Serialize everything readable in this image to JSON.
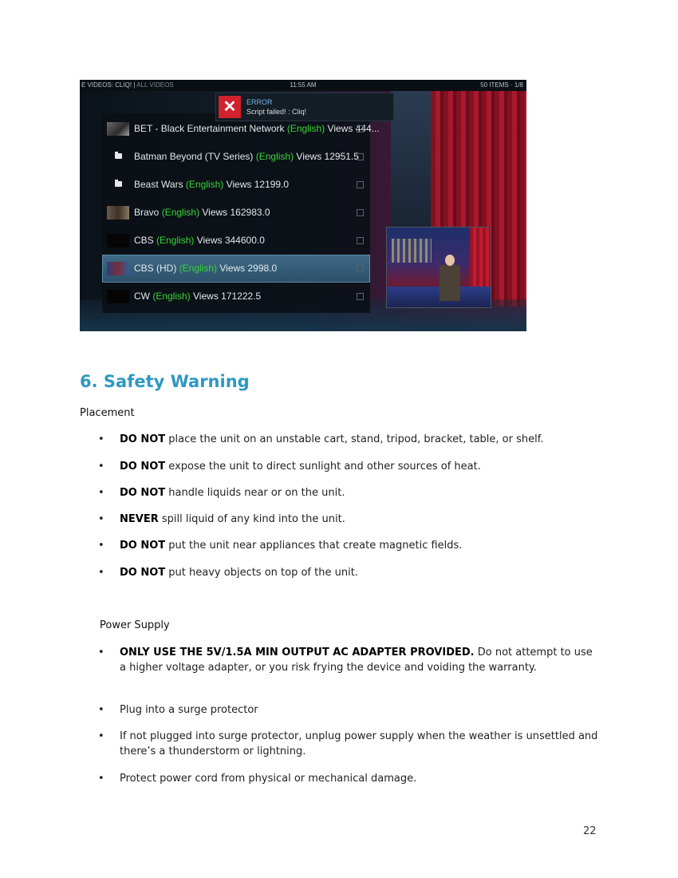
{
  "screenshot": {
    "breadcrumb_main": "E VIDEOS: CLIQ!",
    "breadcrumb_sub": "ALL VIDEOS",
    "clock": "11:55 AM",
    "items_count": "50 ITEMS · 1/8",
    "error": {
      "title": "ERROR",
      "message": "Script failed! : Cliq!"
    },
    "rows": [
      {
        "name": "BET - Black Entertainment Network",
        "lang": "(English)",
        "views": "Views 444...",
        "thumb": "img1",
        "selected": false
      },
      {
        "name": "Batman Beyond (TV Series)",
        "lang": "(English)",
        "views": "Views 12951.5",
        "thumb": "folder",
        "selected": false
      },
      {
        "name": "Beast Wars",
        "lang": "(English)",
        "views": "Views 12199.0",
        "thumb": "folder",
        "selected": false
      },
      {
        "name": "Bravo",
        "lang": "(English)",
        "views": "Views 162983.0",
        "thumb": "img2",
        "selected": false
      },
      {
        "name": "CBS",
        "lang": "(English)",
        "views": "Views 344600.0",
        "thumb": "black",
        "selected": false
      },
      {
        "name": "CBS (HD)",
        "lang": "(English)",
        "views": "Views 2998.0",
        "thumb": "img3",
        "selected": true
      },
      {
        "name": "CW",
        "lang": "(English)",
        "views": "Views 171222.5",
        "thumb": "black",
        "selected": false
      }
    ]
  },
  "section": {
    "heading": "6. Safety Warning",
    "placement_title": "Placement",
    "placement_items": [
      {
        "bold": "DO NOT",
        "text": " place the unit on an unstable cart, stand, tripod, bracket, table, or shelf."
      },
      {
        "bold": "DO NOT",
        "text": " expose the unit to direct sunlight and other sources of heat."
      },
      {
        "bold": "DO NOT",
        "text": " handle liquids near or on the unit."
      },
      {
        "bold": "NEVER",
        "text": " spill liquid of any kind into the unit."
      },
      {
        "bold": "DO NOT",
        "text": " put the unit near appliances that create magnetic fields."
      },
      {
        "bold": "DO NOT",
        "text": " put heavy objects on top of the unit."
      }
    ],
    "power_title": "Power Supply",
    "power_items": [
      {
        "bold": "ONLY USE THE 5V/1.5A MIN OUTPUT AC ADAPTER PROVIDED.",
        "text": " Do not attempt to use a higher voltage adapter, or you risk frying the device and voiding the warranty."
      },
      {
        "bold": "",
        "text": "Plug into a surge protector"
      },
      {
        "bold": "",
        "text": "If not plugged into surge protector, unplug power supply when the weather is unsettled and there’s a thunderstorm or lightning."
      },
      {
        "bold": "",
        "text": "Protect power cord from physical or mechanical damage."
      }
    ]
  },
  "bullet_char": "•",
  "page_number": "22"
}
